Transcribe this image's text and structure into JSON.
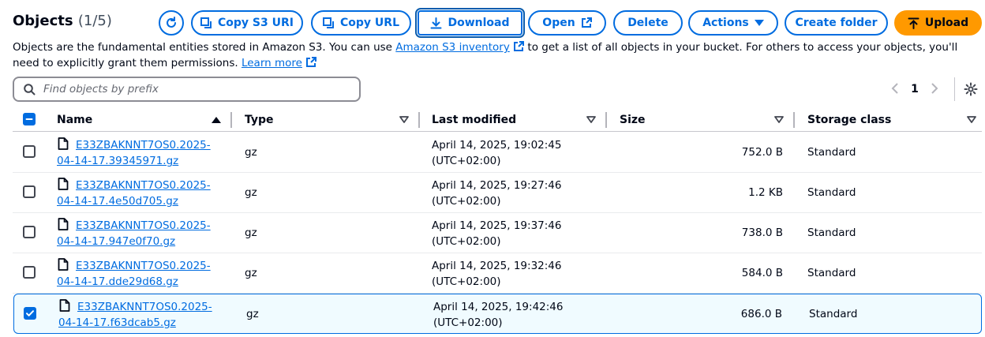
{
  "header": {
    "title": "Objects",
    "count": "(1/5)",
    "buttons": {
      "copy_s3_uri": "Copy S3 URI",
      "copy_url": "Copy URL",
      "download": "Download",
      "open": "Open",
      "delete": "Delete",
      "actions": "Actions",
      "create_folder": "Create folder",
      "upload": "Upload"
    }
  },
  "description": {
    "part1": "Objects are the fundamental entities stored in Amazon S3. You can use ",
    "link_inventory": "Amazon S3 inventory",
    "part2": " to get a list of all objects in your bucket. For others to access your objects, you'll need to explicitly grant them permissions. ",
    "link_learn_more": "Learn more"
  },
  "search": {
    "placeholder": "Find objects by prefix"
  },
  "pagination": {
    "current_page": "1"
  },
  "table": {
    "columns": {
      "name": "Name",
      "type": "Type",
      "last_modified": "Last modified",
      "size": "Size",
      "storage_class": "Storage class"
    },
    "rows": [
      {
        "name_line1": "E33ZBAKNNT7OS0.2025-",
        "name_line2": "04-14-17.39345971.gz",
        "type": "gz",
        "modified_line1": "April 14, 2025, 19:02:45",
        "modified_line2": "(UTC+02:00)",
        "size": "752.0 B",
        "storage_class": "Standard",
        "selected": false
      },
      {
        "name_line1": "E33ZBAKNNT7OS0.2025-",
        "name_line2": "04-14-17.4e50d705.gz",
        "type": "gz",
        "modified_line1": "April 14, 2025, 19:27:46",
        "modified_line2": "(UTC+02:00)",
        "size": "1.2 KB",
        "storage_class": "Standard",
        "selected": false
      },
      {
        "name_line1": "E33ZBAKNNT7OS0.2025-",
        "name_line2": "04-14-17.947e0f70.gz",
        "type": "gz",
        "modified_line1": "April 14, 2025, 19:37:46",
        "modified_line2": "(UTC+02:00)",
        "size": "738.0 B",
        "storage_class": "Standard",
        "selected": false
      },
      {
        "name_line1": "E33ZBAKNNT7OS0.2025-",
        "name_line2": "04-14-17.dde29d68.gz",
        "type": "gz",
        "modified_line1": "April 14, 2025, 19:32:46",
        "modified_line2": "(UTC+02:00)",
        "size": "584.0 B",
        "storage_class": "Standard",
        "selected": false
      },
      {
        "name_line1": "E33ZBAKNNT7OS0.2025-",
        "name_line2": "04-14-17.f63dcab5.gz",
        "type": "gz",
        "modified_line1": "April 14, 2025, 19:42:46",
        "modified_line2": "(UTC+02:00)",
        "size": "686.0 B",
        "storage_class": "Standard",
        "selected": true
      }
    ]
  },
  "colors": {
    "link": "#006ce0",
    "primary_button": "#ff9900",
    "selected_row_bg": "#f0fbff"
  },
  "icons": [
    "refresh-icon",
    "copy-icon",
    "download-icon",
    "external-link-icon",
    "caret-down-icon",
    "upload-icon",
    "search-icon",
    "chevron-left-icon",
    "chevron-right-icon",
    "gear-icon",
    "file-icon",
    "sort-ascending-icon",
    "sort-descending-icon"
  ]
}
